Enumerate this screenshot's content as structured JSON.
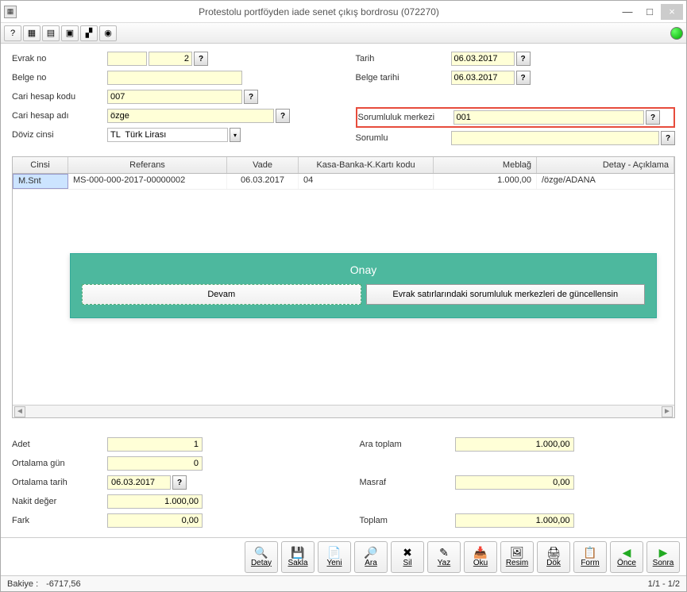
{
  "title": "Protestolu portföyden iade senet çıkış bordrosu (072270)",
  "form": {
    "labels": {
      "evrak_no": "Evrak no",
      "belge_no": "Belge no",
      "cari_hesap_kodu": "Cari hesap kodu",
      "cari_hesap_adi": "Cari hesap adı",
      "doviz_cinsi": "Döviz cinsi",
      "tarih": "Tarih",
      "belge_tarihi": "Belge tarihi",
      "sorumluluk_merkezi": "Sorumluluk merkezi",
      "sorumlu": "Sorumlu"
    },
    "values": {
      "evrak_no_prefix": "",
      "evrak_no": "2",
      "belge_no": "",
      "cari_hesap_kodu": "007",
      "cari_hesap_adi": "özge",
      "doviz_cinsi": "TL  Türk Lirası",
      "tarih": "06.03.2017",
      "belge_tarihi": "06.03.2017",
      "sorumluluk_merkezi": "001",
      "sorumlu": ""
    }
  },
  "grid": {
    "headers": {
      "cinsi": "Cinsi",
      "referans": "Referans",
      "vade": "Vade",
      "kasa": "Kasa-Banka-K.Kartı kodu",
      "meblag": "Meblağ",
      "detay": "Detay - Açıklama"
    },
    "rows": [
      {
        "cinsi": "M.Snt",
        "referans": "MS-000-000-2017-00000002",
        "vade": "06.03.2017",
        "kasa": "04",
        "meblag": "1.000,00",
        "detay": "/özge/ADANA"
      }
    ]
  },
  "confirm": {
    "title": "Onay",
    "btn1": "Devam",
    "btn2": "Evrak satırlarındaki sorumluluk merkezleri de güncellensin"
  },
  "summary": {
    "labels": {
      "adet": "Adet",
      "ortalama_gun": "Ortalama gün",
      "ortalama_tarih": "Ortalama tarih",
      "nakit_deger": "Nakit değer",
      "fark": "Fark",
      "ara_toplam": "Ara toplam",
      "masraf": "Masraf",
      "toplam": "Toplam"
    },
    "values": {
      "adet": "1",
      "ortalama_gun": "0",
      "ortalama_tarih": "06.03.2017",
      "nakit_deger": "1.000,00",
      "fark": "0,00",
      "ara_toplam": "1.000,00",
      "masraf": "0,00",
      "toplam": "1.000,00"
    }
  },
  "buttons": {
    "detay": "Detay",
    "sakla": "Sakla",
    "yeni": "Yeni",
    "ara": "Ara",
    "sil": "Sil",
    "yaz": "Yaz",
    "oku": "Oku",
    "resim": "Resim",
    "dok": "Dök",
    "form": "Form",
    "once": "Önce",
    "sonra": "Sonra"
  },
  "status": {
    "bakiye_label": "Bakiye :",
    "bakiye_value": "-6717,56",
    "pager": "1/1 - 1/2"
  }
}
